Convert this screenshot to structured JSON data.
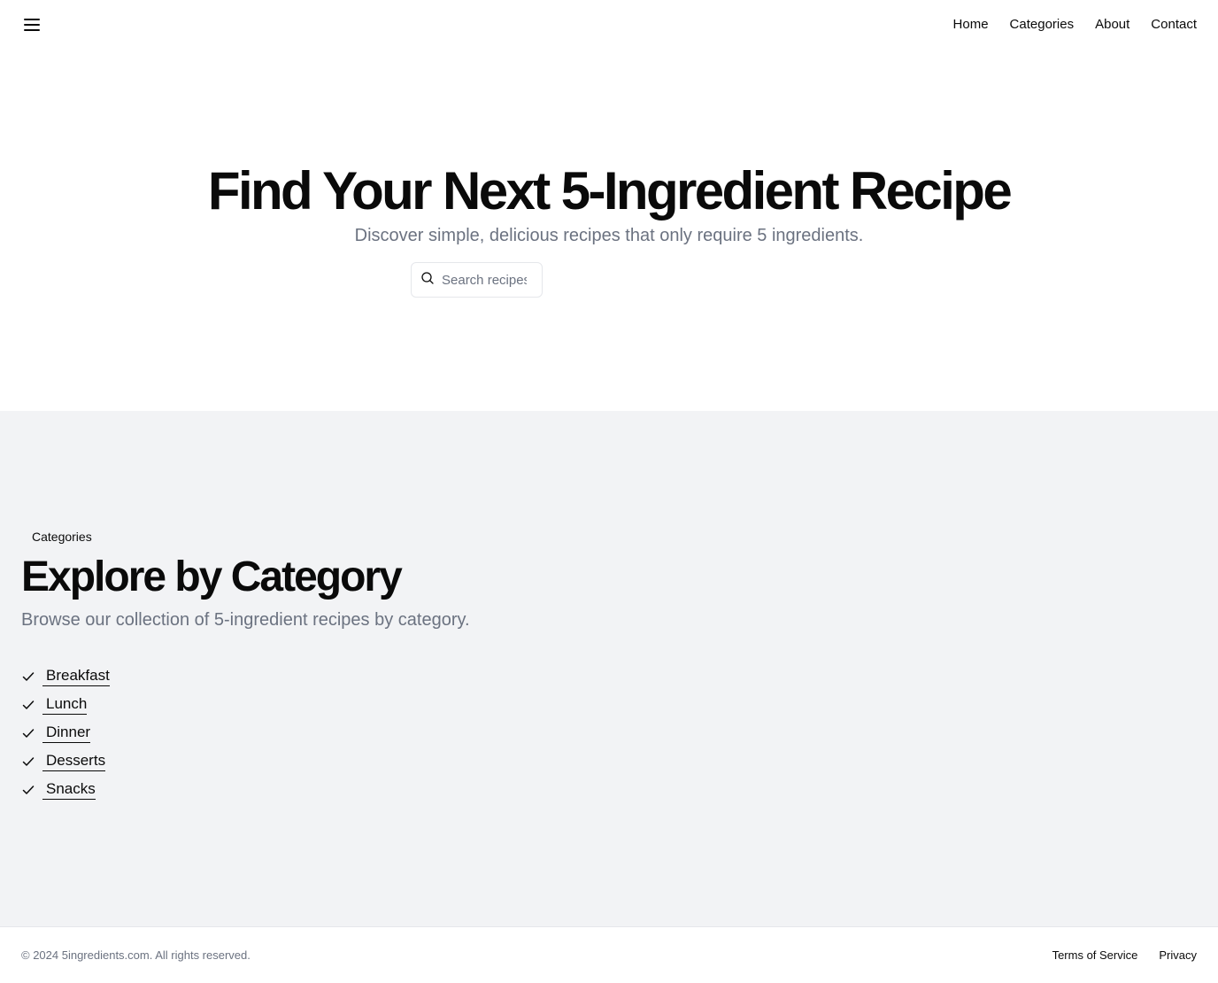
{
  "header": {
    "menu_icon": "hamburger-menu-icon",
    "nav": [
      {
        "label": "Home"
      },
      {
        "label": "Categories"
      },
      {
        "label": "About"
      },
      {
        "label": "Contact"
      }
    ]
  },
  "hero": {
    "title": "Find Your Next 5-Ingredient Recipe",
    "subtitle": "Discover simple, delicious recipes that only require 5 ingredients.",
    "search": {
      "icon": "search-icon",
      "placeholder": "Search recipes...",
      "value": ""
    }
  },
  "categories": {
    "badge": "Categories",
    "title": "Explore by Category",
    "subtitle": "Browse our collection of 5-ingredient recipes by category.",
    "item_icon": "check-icon",
    "items": [
      {
        "label": "Breakfast"
      },
      {
        "label": "Lunch"
      },
      {
        "label": "Dinner"
      },
      {
        "label": "Desserts"
      },
      {
        "label": "Snacks"
      }
    ]
  },
  "footer": {
    "copyright": "© 2024 5ingredients.com. All rights reserved.",
    "links": [
      {
        "label": "Terms of Service"
      },
      {
        "label": "Privacy"
      }
    ]
  },
  "colors": {
    "text": "#0a0a0a",
    "muted": "#6b7280",
    "section_bg": "#f2f3f5",
    "border": "#e5e7eb"
  }
}
